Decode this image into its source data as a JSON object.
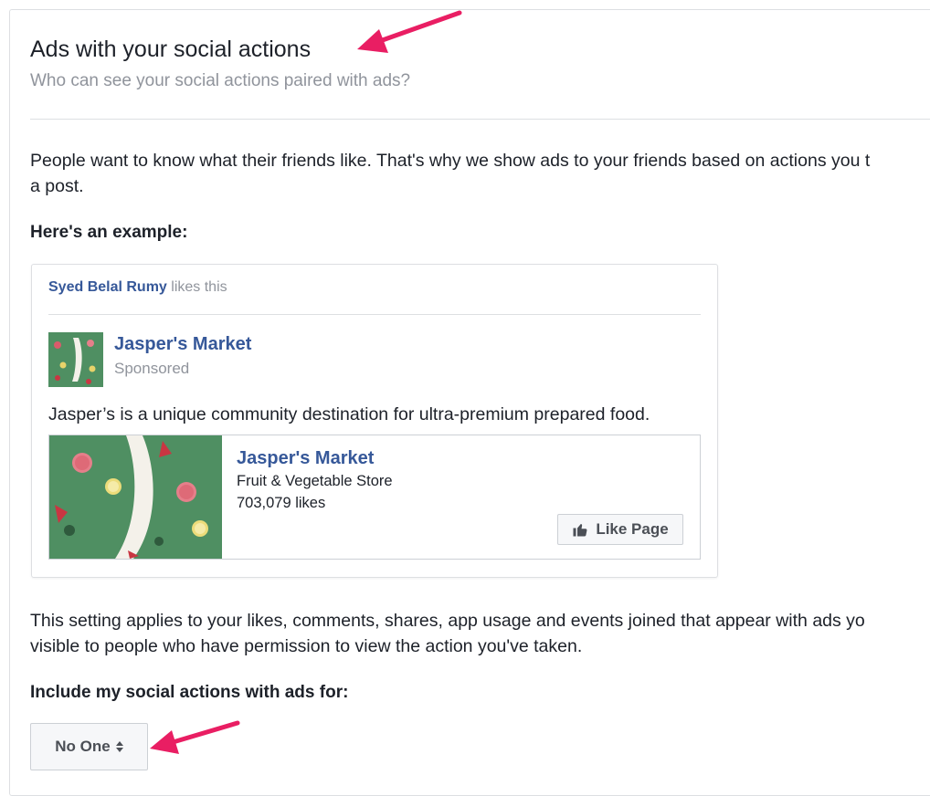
{
  "section": {
    "title": "Ads with your social actions",
    "subtitle": "Who can see your social actions paired with ads?",
    "intro": "People want to know what their friends like. That's why we show ads to your friends based on actions you t",
    "intro_continued": "a post.",
    "example_heading": "Here's an example:"
  },
  "example": {
    "friend_name": "Syed Belal Rumy",
    "action_text": "likes this",
    "page_name": "Jasper's Market",
    "sponsored_label": "Sponsored",
    "ad_text": "Jasper’s is a unique community destination for ultra-premium prepared food.",
    "card": {
      "page_name": "Jasper's Market",
      "category": "Fruit & Vegetable Store",
      "likes": "703,079 likes",
      "like_button_label": "Like Page"
    }
  },
  "setting": {
    "description_line1": "This setting applies to your likes, comments, shares, app usage and events joined that appear with ads yo",
    "description_line2": "visible to people who have permission to view the action you've taken.",
    "label": "Include my social actions with ads for:",
    "selected_value": "No One"
  },
  "colors": {
    "link_blue": "#365899",
    "muted_gray": "#90949c",
    "annotation_pink": "#e91e63",
    "thumb_green": "#4f8f62"
  },
  "icons": [
    "thumbs-up-icon",
    "sort-arrows-icon",
    "annotation-arrow"
  ]
}
